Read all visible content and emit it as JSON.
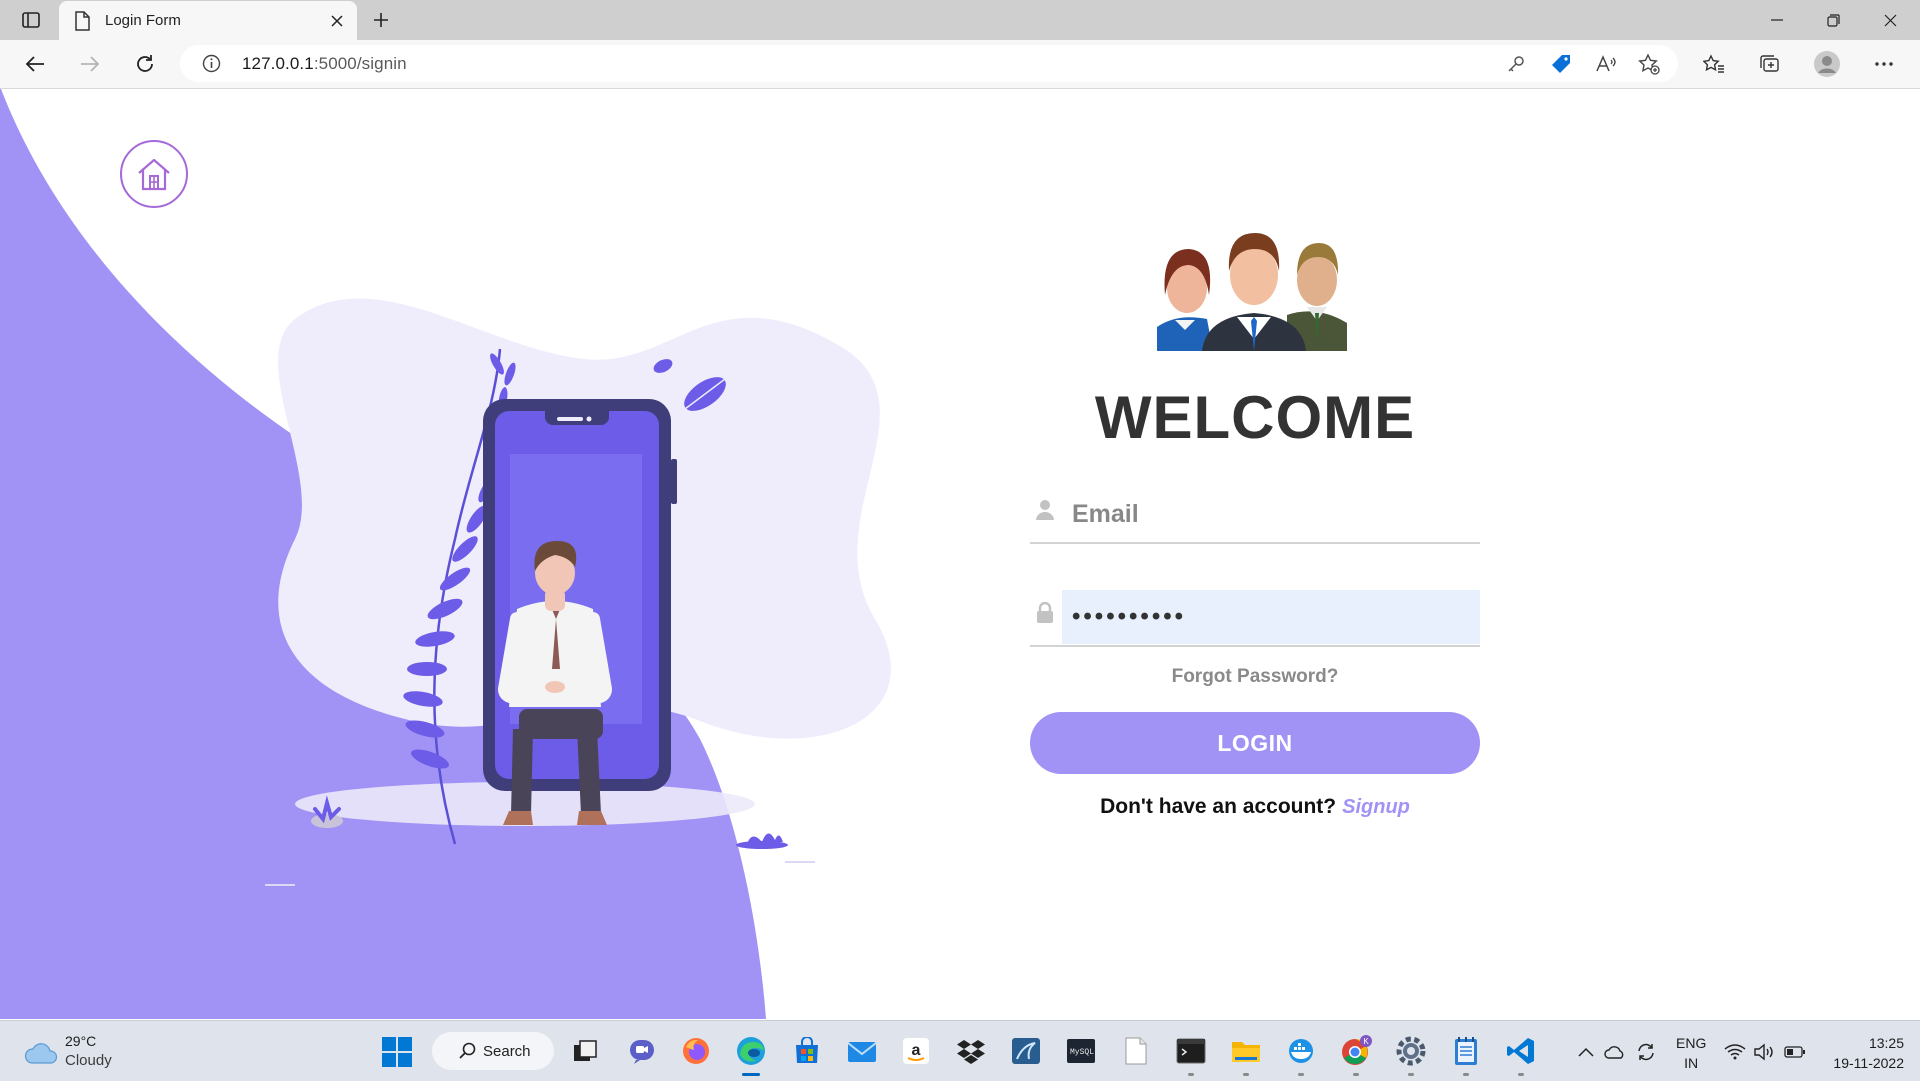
{
  "browser": {
    "tab_title": "Login Form",
    "url_host": "127.0.0.1",
    "url_path": ":5000/signin"
  },
  "page": {
    "welcome": "WELCOME",
    "email_placeholder": "Email",
    "password_value": "••••••••••",
    "forgot_password": "Forgot Password?",
    "login_label": "LOGIN",
    "no_account_text": "Don't have an account?",
    "signup_link": "Signup",
    "colors": {
      "accent": "#a193f6",
      "home_ring": "#a66ad8",
      "wave": "#a193f6",
      "blob": "#efedfc"
    }
  },
  "taskbar": {
    "weather_temp": "29°C",
    "weather_condition": "Cloudy",
    "search_label": "Search",
    "language_line1": "ENG",
    "language_line2": "IN",
    "time": "13:25",
    "date": "19-11-2022",
    "apps": [
      "task-view-icon",
      "teams-icon",
      "firefox-icon",
      "edge-icon",
      "store-icon",
      "mail-icon",
      "amazon-icon",
      "dropbox-icon",
      "mysql-workbench-icon",
      "mysql-shell-icon",
      "file-icon",
      "terminal-icon",
      "file-explorer-icon",
      "docker-icon",
      "chrome-icon",
      "settings-icon",
      "notepad-icon",
      "vscode-icon"
    ]
  }
}
